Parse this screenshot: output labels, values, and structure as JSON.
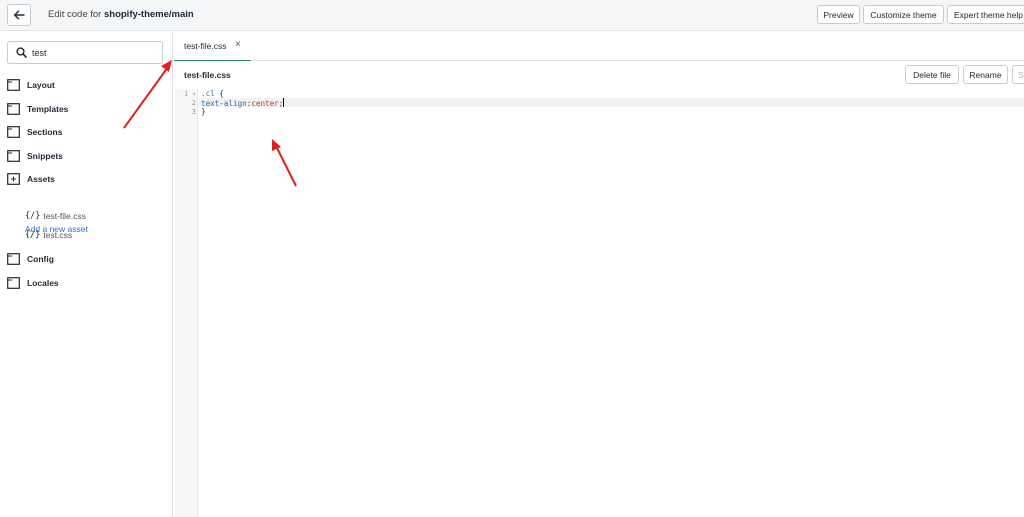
{
  "topbar": {
    "title_prefix": "Edit code for",
    "theme_name": "shopify-theme/main",
    "buttons": [
      {
        "label": "Preview"
      },
      {
        "label": "Customize theme"
      },
      {
        "label": "Expert theme help"
      }
    ]
  },
  "sidebar": {
    "search": {
      "value": "test"
    },
    "folders": [
      {
        "label": "Layout",
        "icon": "folder-icon"
      },
      {
        "label": "Templates",
        "icon": "folder-icon"
      },
      {
        "label": "Sections",
        "icon": "folder-icon"
      },
      {
        "label": "Snippets",
        "icon": "folder-icon"
      },
      {
        "label": "Assets",
        "icon": "folder-open-icon"
      },
      {
        "label": "Config",
        "icon": "folder-icon"
      },
      {
        "label": "Locales",
        "icon": "folder-icon"
      }
    ],
    "add_asset_label": "Add a new asset",
    "assets": [
      {
        "icon_text": "{/}",
        "label": "test-file.css"
      },
      {
        "icon_text": "{/}",
        "label": "test.css"
      }
    ]
  },
  "tabs": [
    {
      "label": "test-file.css",
      "close": "×",
      "active": true
    }
  ],
  "file_header": {
    "filename": "test-file.css",
    "buttons": [
      {
        "label": "Delete file"
      },
      {
        "label": "Rename"
      },
      {
        "label": "S"
      }
    ]
  },
  "editor": {
    "line_numbers": [
      "1",
      "2",
      "3"
    ],
    "fold_marker": "▾",
    "line1": {
      "selector": ".cl",
      "brace": "{"
    },
    "line2": {
      "property": "text-align",
      "colon": ":",
      "value": "center",
      "semicolon": ";"
    },
    "line3": {
      "brace": "}"
    }
  },
  "colors": {
    "accent_underline": "#2e8a62",
    "link": "#2c6ecb",
    "annotation_arrow": "#e02020"
  }
}
